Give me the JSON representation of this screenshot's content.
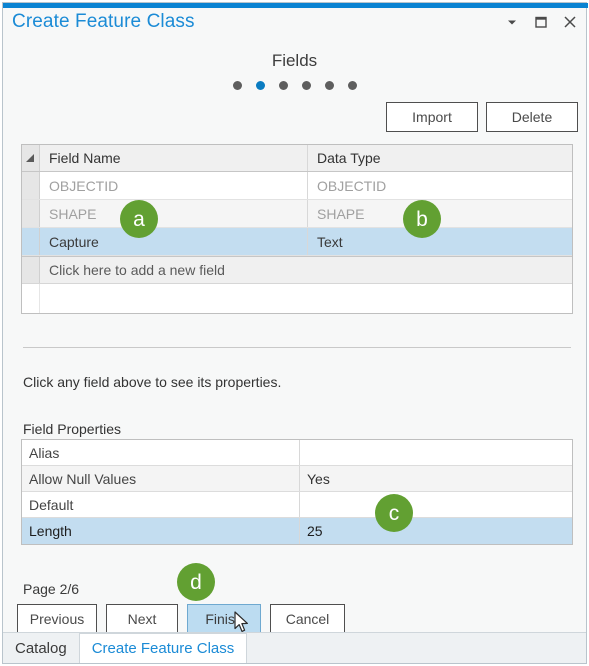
{
  "window": {
    "title": "Create Feature Class",
    "accent_color": "#0a83d2",
    "title_color": "#1b8bd6",
    "controls": [
      {
        "name": "minimize-dropdown",
        "label": "▾"
      },
      {
        "name": "maximize",
        "label": "❐"
      },
      {
        "name": "close",
        "label": "✕"
      }
    ]
  },
  "wizard": {
    "page_title": "Fields",
    "step_count": 6,
    "active_step": 2,
    "page_indicator": "Page 2/6",
    "toolbar": {
      "import_label": "Import",
      "delete_label": "Delete"
    },
    "nav": {
      "previous_label": "Previous",
      "next_label": "Next",
      "finish_label": "Finish",
      "cancel_label": "Cancel",
      "hovered_button": "Finish"
    }
  },
  "fields_grid": {
    "columns": [
      "Field Name",
      "Data Type"
    ],
    "rows": [
      {
        "field_name": "OBJECTID",
        "data_type": "OBJECTID",
        "state": "readonly"
      },
      {
        "field_name": "SHAPE",
        "data_type": "SHAPE",
        "state": "readonly"
      },
      {
        "field_name": "Capture",
        "data_type": "Text",
        "state": "selected"
      }
    ],
    "add_row_label": "Click here to add a new field"
  },
  "properties": {
    "hint": "Click any field above to see its properties.",
    "section_label": "Field Properties",
    "rows": [
      {
        "key": "Alias",
        "value": "",
        "state": "normal"
      },
      {
        "key": "Allow Null Values",
        "value": "Yes",
        "state": "alt"
      },
      {
        "key": "Default",
        "value": "",
        "state": "normal"
      },
      {
        "key": "Length",
        "value": "25",
        "state": "selected"
      }
    ]
  },
  "tabs": [
    {
      "label": "Catalog",
      "active": false
    },
    {
      "label": "Create Feature Class",
      "active": true
    }
  ],
  "annotations": {
    "badge_color": "#62a032",
    "items": [
      {
        "id": "a",
        "label": "a"
      },
      {
        "id": "b",
        "label": "b"
      },
      {
        "id": "c",
        "label": "c"
      },
      {
        "id": "d",
        "label": "d"
      }
    ]
  }
}
